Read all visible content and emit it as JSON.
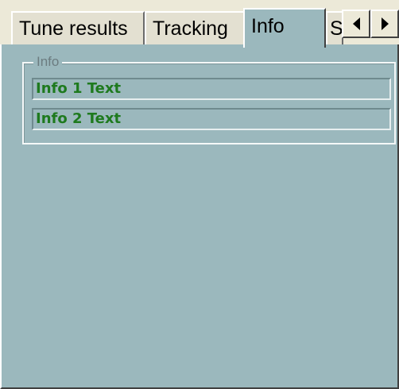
{
  "tabs": [
    {
      "label": "Tune results",
      "active": false
    },
    {
      "label": "Tracking",
      "active": false
    },
    {
      "label": "Info",
      "active": true
    },
    {
      "label": "S",
      "active": false
    }
  ],
  "info_group": {
    "legend": "Info",
    "fields": [
      "Info 1 Text",
      "Info 2 Text"
    ]
  },
  "icons": {
    "scroll_left": "arrow-left-icon",
    "scroll_right": "arrow-right-icon"
  },
  "colors": {
    "panel": "#9bb8bd",
    "text_green": "#1e7a1e",
    "tabstrip": "#ece9d8"
  }
}
